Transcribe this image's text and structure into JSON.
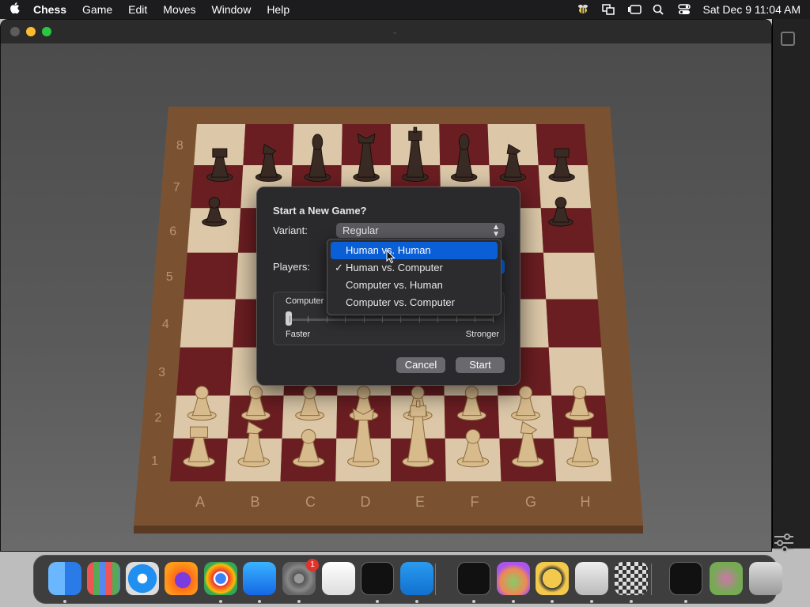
{
  "menubar": {
    "apple": "",
    "app_name": "Chess",
    "items": [
      "Game",
      "Edit",
      "Moves",
      "Window",
      "Help"
    ],
    "datetime": "Sat Dec 9  11:04 AM",
    "status_icons": [
      "bee-icon",
      "display-mirror-icon",
      "stage-manager-icon",
      "search-icon",
      "control-center-icon"
    ]
  },
  "board": {
    "ranks": [
      "8",
      "7",
      "6",
      "5",
      "4",
      "3",
      "2",
      "1"
    ],
    "files": [
      "A",
      "B",
      "C",
      "D",
      "E",
      "F",
      "G",
      "H"
    ],
    "colors": {
      "frame": "#7a5232",
      "light": "#dcc8a8",
      "dark": "#6b1e22"
    }
  },
  "dialog": {
    "title": "Start a New Game?",
    "variant_label": "Variant:",
    "variant_value": "Regular",
    "players_label": "Players:",
    "computer_label": "Computer",
    "faster_label": "Faster",
    "stronger_label": "Stronger",
    "cancel_label": "Cancel",
    "start_label": "Start",
    "strength_level": 0
  },
  "players_menu": {
    "options": [
      {
        "label": "Human vs. Human",
        "highlighted": true,
        "checked": false
      },
      {
        "label": "Human vs. Computer",
        "highlighted": false,
        "checked": true
      },
      {
        "label": "Computer vs. Human",
        "highlighted": false,
        "checked": false
      },
      {
        "label": "Computer vs. Computer",
        "highlighted": false,
        "checked": false
      }
    ],
    "check_glyph": "✓",
    "accent": "#0a5fd6"
  },
  "dock": {
    "apps": [
      "finder-icon",
      "launchpad-icon",
      "safari-icon",
      "firefox-icon",
      "chrome-icon",
      "app-store-icon",
      "system-settings-icon",
      "textedit-icon",
      "terminal-icon",
      "vscode-icon",
      "activity-monitor-icon",
      "colorsync-icon",
      "bee-app-icon",
      "disk-utility-icon",
      "chess-icon",
      "window-preview-icon",
      "colorsync-window-icon",
      "trash-icon"
    ],
    "settings_badge": "1"
  }
}
